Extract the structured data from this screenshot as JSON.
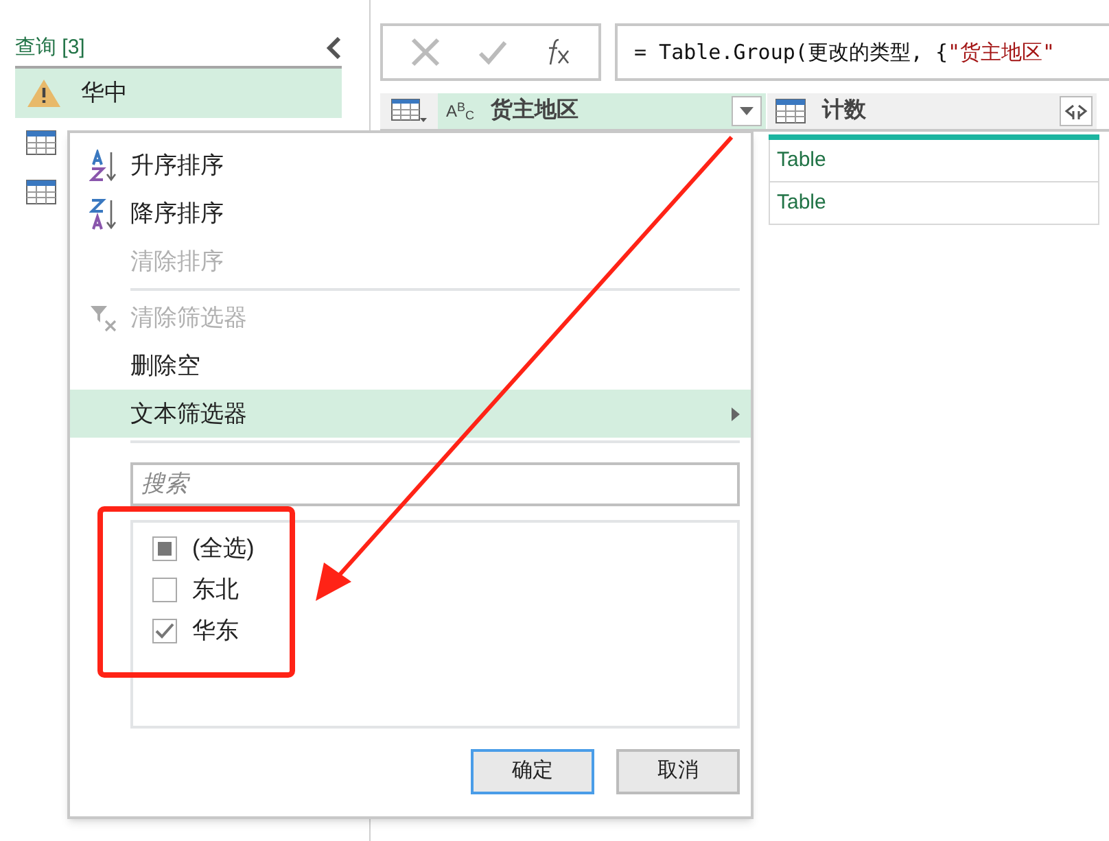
{
  "queries": {
    "title": "查询 [3]",
    "items": [
      {
        "label": "华中",
        "kind": "warning",
        "selected": true
      },
      {
        "kind": "table",
        "selected": false
      },
      {
        "kind": "table",
        "selected": false
      }
    ]
  },
  "formula": {
    "text": "= Table.Group(更改的类型, {",
    "string": "\"货主地区\""
  },
  "columns": [
    {
      "label": "货主地区",
      "kind": "text",
      "type_icon": "A$^{B}$$_{C}$",
      "selected": true
    },
    {
      "label": "计数",
      "kind": "table",
      "selected": false
    }
  ],
  "rows": [
    {
      "value": "Table"
    },
    {
      "value": "Table"
    }
  ],
  "menu": {
    "items": [
      {
        "kind": "sort-asc",
        "label": "升序排序",
        "disabled": false,
        "selected": false
      },
      {
        "kind": "sort-desc",
        "label": "降序排序",
        "disabled": false,
        "selected": false
      },
      {
        "kind": "plain",
        "label": "清除排序",
        "disabled": true,
        "selected": false
      },
      {
        "kind": "separator"
      },
      {
        "kind": "clear-filter",
        "label": "清除筛选器",
        "disabled": true,
        "selected": false
      },
      {
        "kind": "plain",
        "label": "删除空",
        "disabled": false,
        "selected": false
      },
      {
        "kind": "submenu",
        "label": "文本筛选器",
        "disabled": false,
        "selected": true
      },
      {
        "kind": "separator"
      }
    ],
    "search": {
      "placeholder": "搜索"
    },
    "select_all": {
      "label": "(全选)",
      "checked": false,
      "indeterminate": true
    },
    "options": [
      {
        "label": "东北",
        "checked": false
      },
      {
        "label": "华东",
        "checked": true
      }
    ],
    "buttons": [
      {
        "label": "确定",
        "default": true
      },
      {
        "label": "取消",
        "default": false
      }
    ]
  }
}
